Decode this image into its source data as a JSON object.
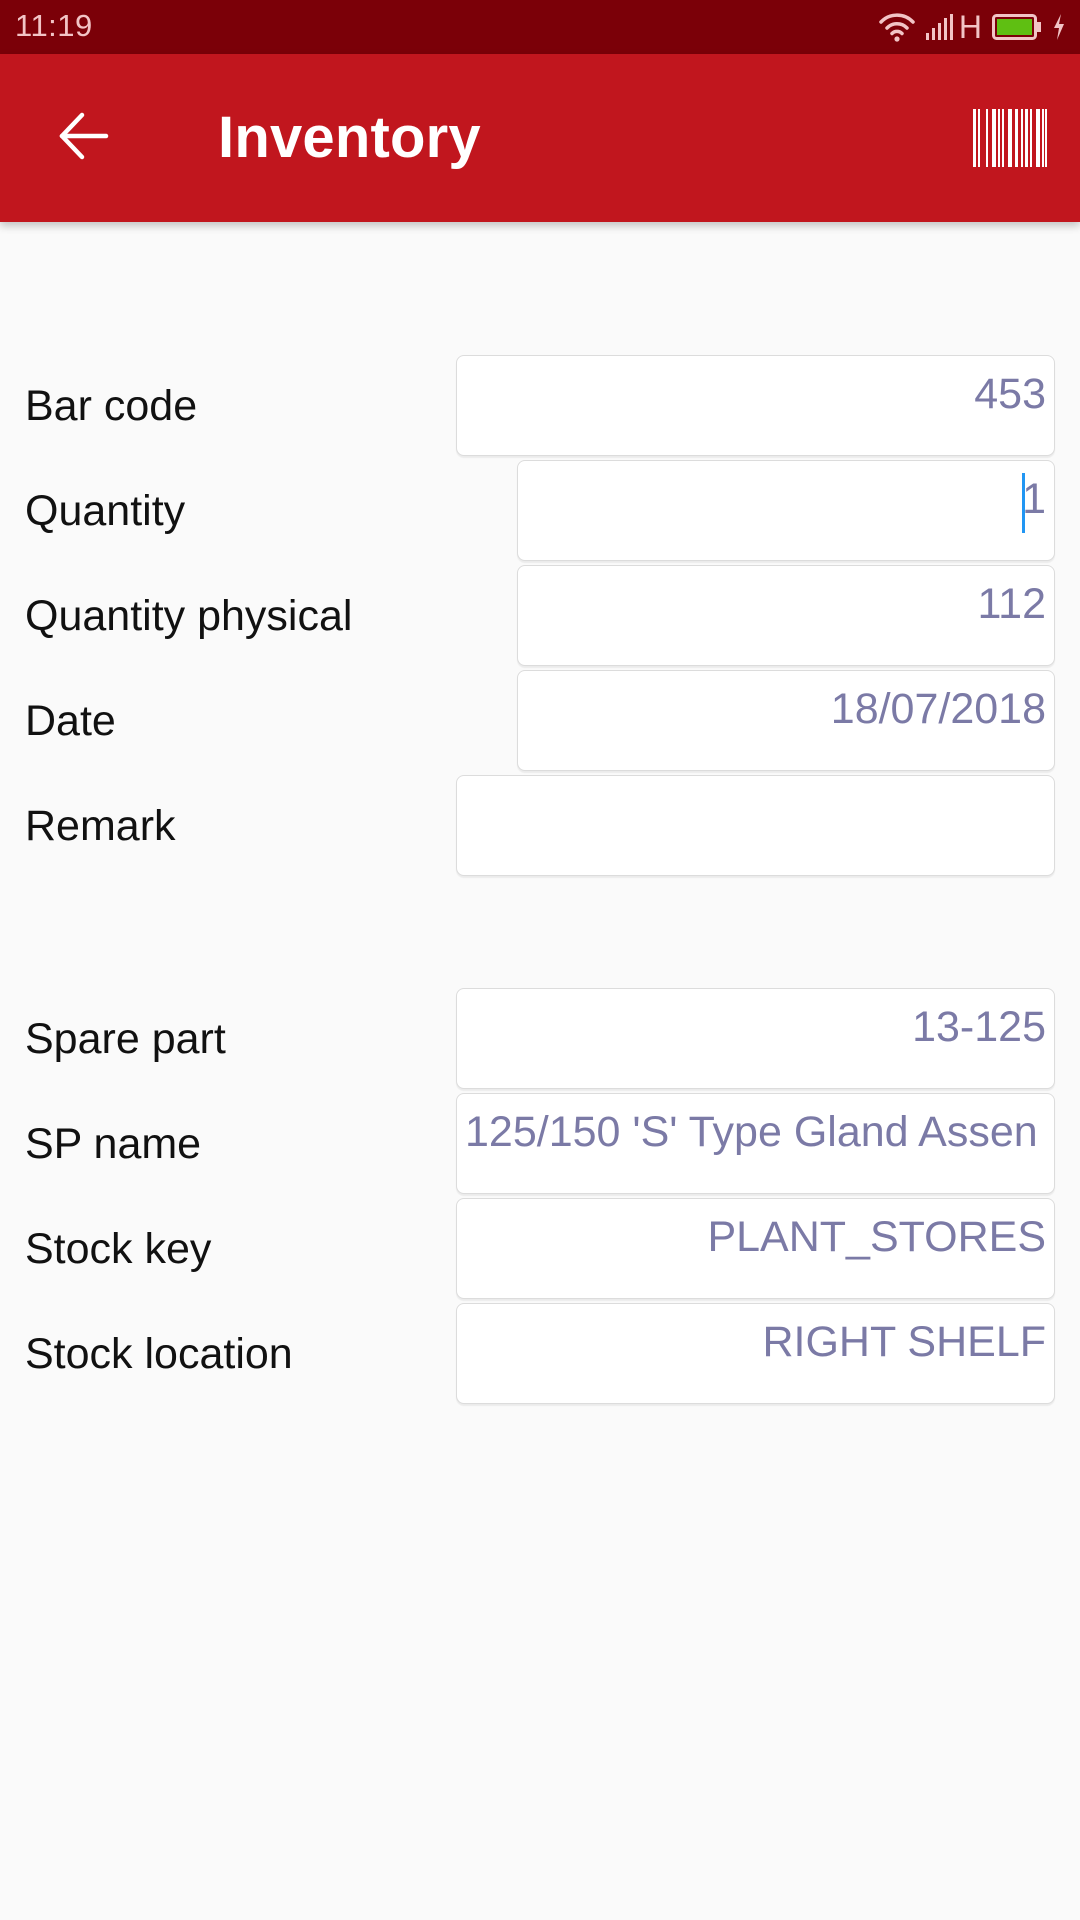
{
  "status_bar": {
    "time": "11:19",
    "network_type": "H",
    "icons": [
      "wifi-icon",
      "signal-icon",
      "battery-icon",
      "charging-icon"
    ],
    "battery_color": "#5fbf12"
  },
  "app_bar": {
    "title": "Inventory",
    "back_icon": "arrow-left-icon",
    "action_icon": "barcode-scan-icon",
    "color": "#c1161e"
  },
  "form": {
    "section1": [
      {
        "label": "Bar code",
        "value": "453"
      },
      {
        "label": "Quantity",
        "value": "1",
        "focused": true
      },
      {
        "label": "Quantity physical",
        "value": "112"
      },
      {
        "label": "Date",
        "value": "18/07/2018"
      },
      {
        "label": "Remark",
        "value": ""
      }
    ],
    "section2": [
      {
        "label": "Spare part",
        "value": "13-125"
      },
      {
        "label": "SP name",
        "value": "125/150 'S' Type Gland Assen"
      },
      {
        "label": "Stock key",
        "value": "PLANT_STORES"
      },
      {
        "label": "Stock location",
        "value": "RIGHT SHELF"
      }
    ]
  }
}
